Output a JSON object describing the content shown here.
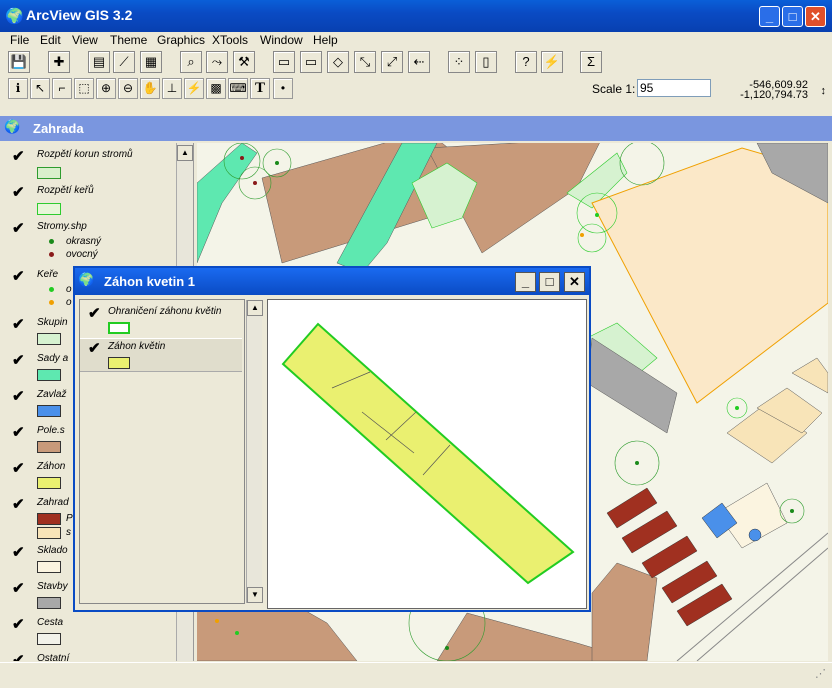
{
  "app": {
    "title": "ArcView GIS 3.2"
  },
  "window_controls": {
    "minimize": "_",
    "maximize": "□",
    "close": "✕"
  },
  "menu": [
    "File",
    "Edit",
    "View",
    "Theme",
    "Graphics",
    "XTools",
    "Window",
    "Help"
  ],
  "toolbar1": {
    "icons": [
      "save-icon",
      "add-theme-icon",
      "theme-properties-icon",
      "edit-legend-icon",
      "open-table-icon",
      "find-icon",
      "locate-address-icon",
      "query-builder-icon",
      "zoom-full-extent-icon",
      "zoom-active-theme-icon",
      "zoom-selected-icon",
      "zoom-in-fixed-icon",
      "zoom-out-fixed-icon",
      "zoom-previous-icon",
      "select-by-theme-icon",
      "clear-selection-icon",
      "help-icon",
      "hotlink-icon",
      "summarize-icon"
    ]
  },
  "toolbar2": {
    "icons": [
      "identify-icon",
      "pointer-icon",
      "vertex-edit-icon",
      "select-feature-icon",
      "zoom-in-icon",
      "zoom-out-icon",
      "pan-icon",
      "measure-icon",
      "hotlink-tool-icon",
      "label-icon",
      "callout-icon",
      "text-icon",
      "draw-point-icon"
    ],
    "scale_label": "Scale 1:",
    "scale_value": "95",
    "coord_x": "-546,609.92",
    "coord_y": "-1,120,794.73"
  },
  "view": {
    "title": "Zahrada"
  },
  "toc": {
    "themes": [
      {
        "name": "Rozpětí korun stromů",
        "color": "#d9f0cc",
        "stroke": "#2e9c2e"
      },
      {
        "name": "Rozpětí keřů",
        "color": "#e8f6d8",
        "stroke": "#2ecc2e"
      },
      {
        "name": "Stromy.shp",
        "items": [
          {
            "label": "okrasný",
            "color": "#1a8a1a"
          },
          {
            "label": "ovocný",
            "color": "#8a1a1a"
          }
        ]
      },
      {
        "name": "Keře",
        "items": [
          {
            "label": "o",
            "color": "#22cc22"
          },
          {
            "label": "o",
            "color": "#f0a000"
          }
        ]
      },
      {
        "name": "Skupin",
        "color": "#d6f2d0"
      },
      {
        "name": "Sady a",
        "color": "#5ee8b0"
      },
      {
        "name": "Zavlaž",
        "color": "#4a90ea"
      },
      {
        "name": "Pole.s",
        "color": "#c89a7a"
      },
      {
        "name": "Záhon",
        "color": "#eaf070"
      },
      {
        "name": "Zahrad",
        "items": [
          {
            "label": "P",
            "color": "#a03020"
          },
          {
            "label": "s",
            "color": "#f8e4b8"
          }
        ]
      },
      {
        "name": "Sklado",
        "color": "#fbf4e0"
      },
      {
        "name": "Stavby",
        "color": "#a8a8a8"
      },
      {
        "name": "Cesta",
        "color": "#f2f2ea"
      },
      {
        "name": "Ostatní"
      }
    ]
  },
  "child": {
    "title": "Záhon kvetin 1",
    "themes": [
      {
        "name": "Ohraničení záhonu květin",
        "color": "#ffffff",
        "stroke": "#22cc22"
      },
      {
        "name": "Záhon květin",
        "color": "#eaf070",
        "stroke": "#555555"
      }
    ]
  },
  "colors": {
    "title_bar": "#0a4bc4",
    "view_title": "#7a96df",
    "field": "#c89a7a",
    "orchard": "#5ee8b0",
    "garden_red": "#a03020",
    "flowerbed": "#eaf070",
    "outline_green": "#22cc22"
  }
}
